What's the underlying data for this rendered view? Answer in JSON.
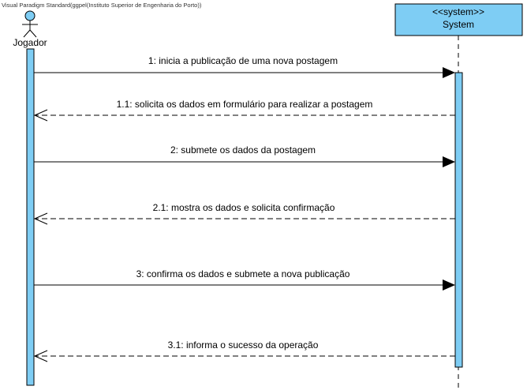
{
  "watermark": "Visual Paradigm Standard(ggpel(Instituto Superior de Engenharia do Porto))",
  "actor": {
    "name": "Jogador"
  },
  "system": {
    "stereotype": "<<system>>",
    "name": "System"
  },
  "colors": {
    "fill": "#7ecdf4",
    "stroke": "#000000"
  },
  "messages": [
    {
      "label": "1: inicia a publicação de uma nova postagem",
      "kind": "sync"
    },
    {
      "label": "1.1: solicita os dados em formulário para realizar a postagem",
      "kind": "reply"
    },
    {
      "label": "2: submete os dados da postagem",
      "kind": "sync"
    },
    {
      "label": "2.1: mostra os dados e solicita confirmação",
      "kind": "reply"
    },
    {
      "label": "3: confirma os dados e submete a nova publicação",
      "kind": "sync"
    },
    {
      "label": "3.1: informa o sucesso da operação",
      "kind": "reply"
    }
  ]
}
